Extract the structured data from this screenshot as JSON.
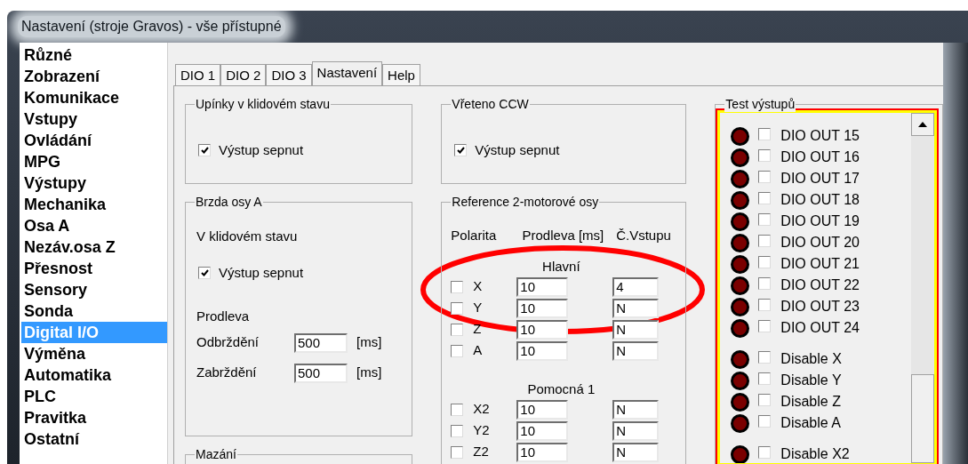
{
  "window": {
    "title": "Nastavení (stroje Gravos) - vše přístupné"
  },
  "sidebar": {
    "items": [
      {
        "label": "Různé",
        "selected": false
      },
      {
        "label": "Zobrazení",
        "selected": false
      },
      {
        "label": "Komunikace",
        "selected": false
      },
      {
        "label": "Vstupy",
        "selected": false
      },
      {
        "label": "Ovládání",
        "selected": false
      },
      {
        "label": "MPG",
        "selected": false
      },
      {
        "label": "Výstupy",
        "selected": false
      },
      {
        "label": "Mechanika",
        "selected": false
      },
      {
        "label": "Osa A",
        "selected": false
      },
      {
        "label": "Nezáv.osa Z",
        "selected": false
      },
      {
        "label": "Přesnost",
        "selected": false
      },
      {
        "label": "Sensory",
        "selected": false
      },
      {
        "label": "Sonda",
        "selected": false
      },
      {
        "label": "Digital I/O",
        "selected": true
      },
      {
        "label": "Výměna",
        "selected": false
      },
      {
        "label": "Automatika",
        "selected": false
      },
      {
        "label": "PLC",
        "selected": false
      },
      {
        "label": "Pravitka",
        "selected": false
      },
      {
        "label": "Ostatní",
        "selected": false
      }
    ]
  },
  "tabs": [
    {
      "label": "DIO 1",
      "selected": false
    },
    {
      "label": "DIO 2",
      "selected": false
    },
    {
      "label": "DIO 3",
      "selected": false
    },
    {
      "label": "Nastavení",
      "selected": true
    },
    {
      "label": "Help",
      "selected": false
    }
  ],
  "clamps": {
    "title": "Upínky v klidovém stavu",
    "checkbox": {
      "label": "Výstup sepnut",
      "checked": true
    }
  },
  "brake": {
    "title": "Brzda osy A",
    "subtitle": "V klidovém stavu",
    "checkbox": {
      "label": "Výstup sepnut",
      "checked": true
    },
    "delay_label": "Prodleva",
    "fields": [
      {
        "label": "Odbrždění",
        "value": "500",
        "unit": "[ms]"
      },
      {
        "label": "Zabrždění",
        "value": "500",
        "unit": "[ms]"
      }
    ]
  },
  "lubrication": {
    "title": "Mazání"
  },
  "spindle": {
    "title": "Vřeteno CCW",
    "checkbox": {
      "label": "Výstup sepnut",
      "checked": true
    }
  },
  "reference": {
    "title": "Reference 2-motorové osy",
    "columns": [
      "Polarita",
      "Prodleva [ms]",
      "Č.Vstupu"
    ],
    "sections": [
      {
        "title": "Hlavní",
        "rows": [
          {
            "axis": "X",
            "checked": false,
            "delay": "10",
            "input": "4"
          },
          {
            "axis": "Y",
            "checked": false,
            "delay": "10",
            "input": "N"
          },
          {
            "axis": "Z",
            "checked": false,
            "delay": "10",
            "input": "N"
          },
          {
            "axis": "A",
            "checked": false,
            "delay": "10",
            "input": "N"
          }
        ]
      },
      {
        "title": "Pomocná 1",
        "rows": [
          {
            "axis": "X2",
            "checked": false,
            "delay": "10",
            "input": "N"
          },
          {
            "axis": "Y2",
            "checked": false,
            "delay": "10",
            "input": "N"
          },
          {
            "axis": "Z2",
            "checked": false,
            "delay": "10",
            "input": "N"
          }
        ]
      }
    ]
  },
  "outputs": {
    "title": "Test výstupů",
    "groups": [
      [
        {
          "label": "DIO OUT 15",
          "on": false,
          "checked": false
        },
        {
          "label": "DIO OUT 16",
          "on": false,
          "checked": false
        },
        {
          "label": "DIO OUT 17",
          "on": false,
          "checked": false
        },
        {
          "label": "DIO OUT 18",
          "on": false,
          "checked": false
        },
        {
          "label": "DIO OUT 19",
          "on": false,
          "checked": false
        },
        {
          "label": "DIO OUT 20",
          "on": false,
          "checked": false
        },
        {
          "label": "DIO OUT 21",
          "on": false,
          "checked": false
        },
        {
          "label": "DIO OUT 22",
          "on": false,
          "checked": false
        },
        {
          "label": "DIO OUT 23",
          "on": false,
          "checked": false
        },
        {
          "label": "DIO OUT 24",
          "on": false,
          "checked": false
        }
      ],
      [
        {
          "label": "Disable X",
          "on": false,
          "checked": false
        },
        {
          "label": "Disable Y",
          "on": false,
          "checked": false
        },
        {
          "label": "Disable Z",
          "on": false,
          "checked": false
        },
        {
          "label": "Disable A",
          "on": false,
          "checked": false
        }
      ],
      [
        {
          "label": "Disable X2",
          "on": false,
          "checked": false
        }
      ]
    ]
  }
}
